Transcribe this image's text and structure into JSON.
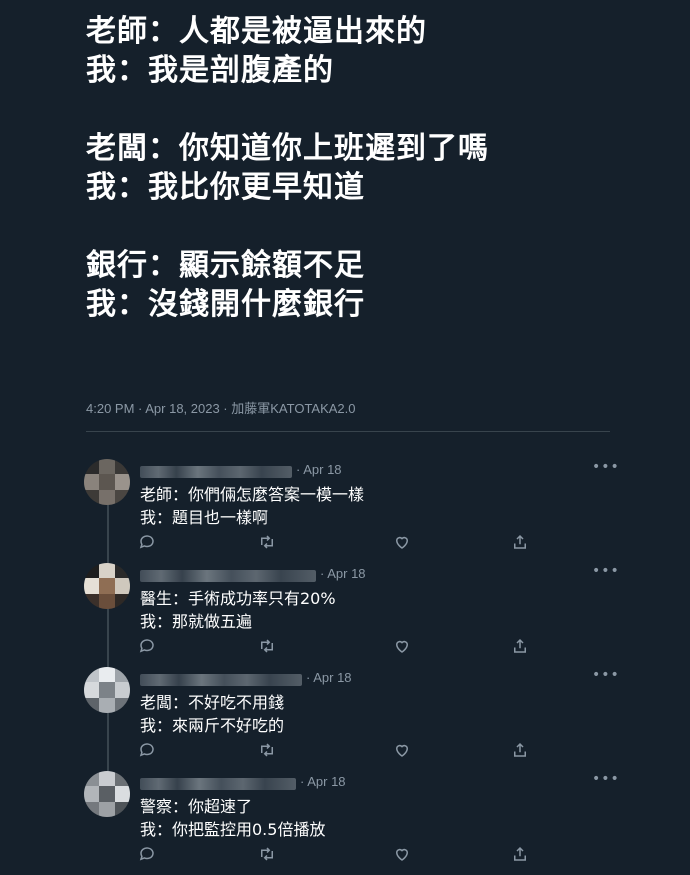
{
  "tweet": {
    "lines": [
      "老師：人都是被逼出來的",
      "我：我是剖腹產的",
      "老闆：你知道你上班遲到了嗎",
      "我：我比你更早知道",
      "銀行：顯示餘額不足",
      "我：沒錢開什麼銀行"
    ],
    "meta": "4:20 PM · Apr 18, 2023 · 加藤軍KATOTAKA2.0"
  },
  "replies": [
    {
      "date": "· Apr 18",
      "lines": [
        "老師：你們倆怎麼答案一模一樣",
        "我：題目也一樣啊"
      ]
    },
    {
      "date": "· Apr 18",
      "lines": [
        "醫生：手術成功率只有20%",
        "我：那就做五遍"
      ]
    },
    {
      "date": "· Apr 18",
      "lines": [
        "老闆：不好吃不用錢",
        "我：來兩斤不好吃的"
      ]
    },
    {
      "date": "· Apr 18",
      "lines": [
        "警察：你超速了",
        "我：你把監控用0.5倍播放"
      ]
    }
  ],
  "more_label": "•••",
  "icons": [
    "reply-icon",
    "retweet-icon",
    "like-icon",
    "share-icon",
    "more-icon"
  ],
  "colors": {
    "background": "#15202b",
    "text": "#ffffff",
    "muted": "#8b98a5",
    "border": "#38444d"
  }
}
